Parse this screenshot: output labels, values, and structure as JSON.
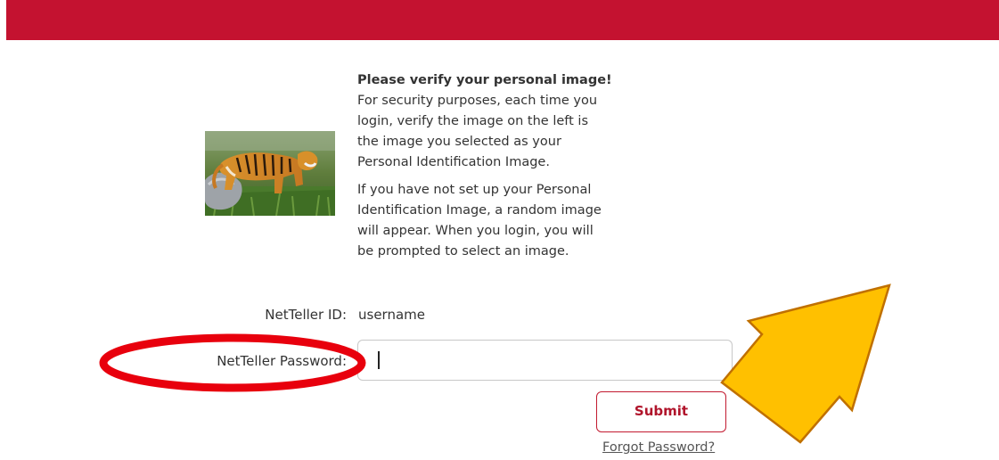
{
  "colors": {
    "brand_red": "#c41230",
    "annotation_red": "#e8000d",
    "arrow_fill": "#ffc000",
    "arrow_stroke": "#c07000"
  },
  "verify": {
    "title": "Please verify your personal image!",
    "paragraph1_lines": [
      "For security purposes, each time you",
      "login, verify the image on the left is",
      "the image you selected as your",
      "Personal Identification Image."
    ],
    "paragraph2_lines": [
      "If you have not set up your Personal",
      "Identification Image, a random image",
      "will appear. When you login, you will",
      "be prompted to select an image."
    ]
  },
  "login": {
    "id_label": "NetTeller ID:",
    "id_value": "username",
    "password_label": "NetTeller Password:",
    "password_value": "",
    "submit_label": "Submit",
    "forgot_label": "Forgot Password?"
  },
  "icons": {
    "personal_image": "tiger-photo",
    "highlight": "red-ellipse",
    "pointer": "yellow-arrow"
  }
}
